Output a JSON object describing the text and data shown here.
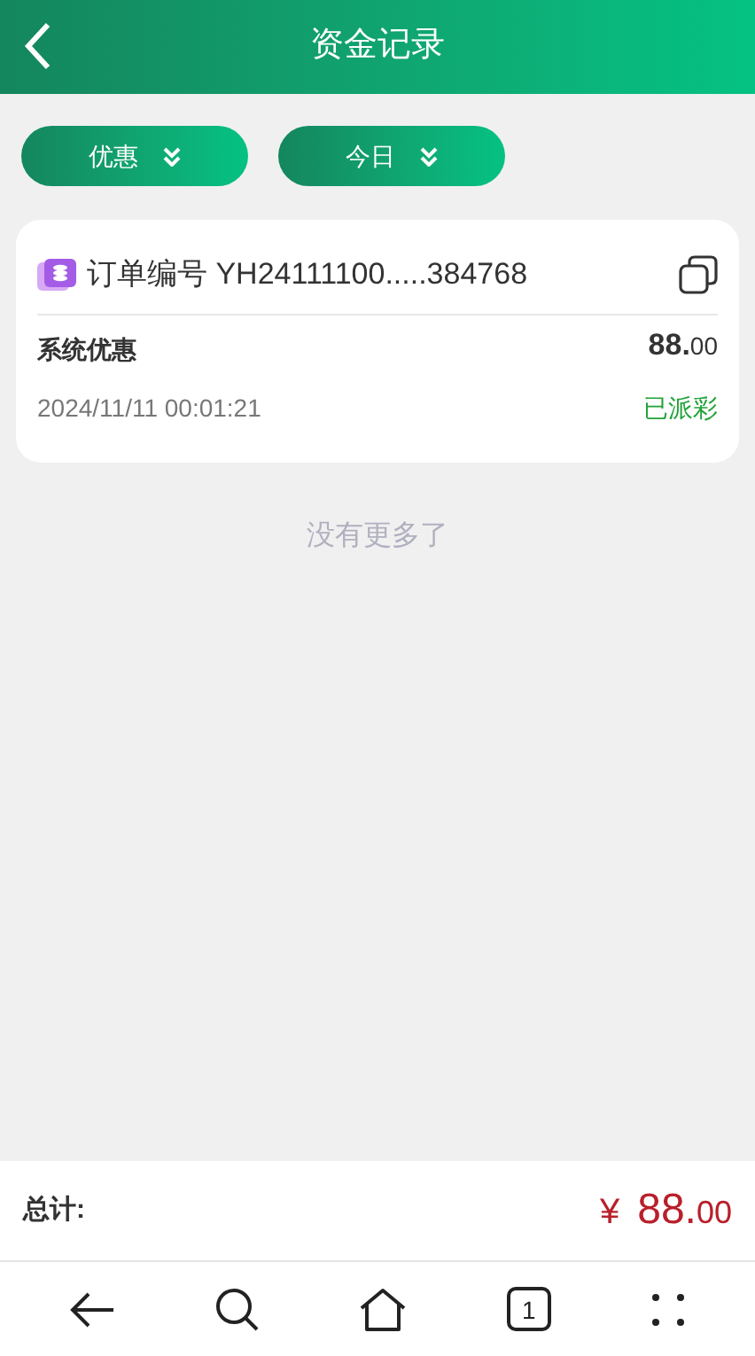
{
  "header": {
    "title": "资金记录"
  },
  "filters": [
    {
      "label": "优惠"
    },
    {
      "label": "今日"
    }
  ],
  "records": [
    {
      "order_label": "订单编号 YH24111100.....384768",
      "type": "系统优惠",
      "amount_main": "88.",
      "amount_decimal": "00",
      "time": "2024/11/11 00:01:21",
      "status": "已派彩"
    }
  ],
  "end_message": "没有更多了",
  "total": {
    "label": "总计:",
    "currency": "¥",
    "amount_main": "88.",
    "amount_decimal": "00"
  },
  "nav_bar": {
    "tab_count": "1"
  }
}
